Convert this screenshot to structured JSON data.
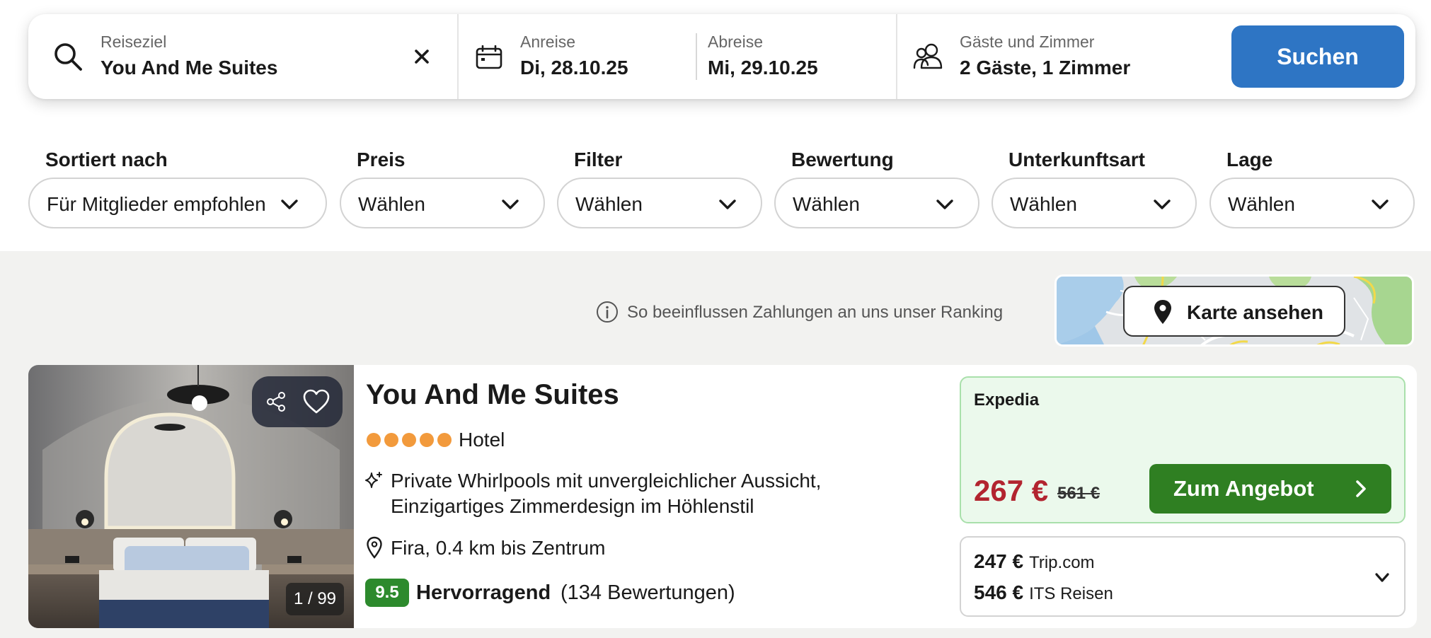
{
  "search": {
    "destination_label": "Reiseziel",
    "destination_value": "You And Me Suites",
    "checkin_label": "Anreise",
    "checkin_value": "Di, 28.10.25",
    "checkout_label": "Abreise",
    "checkout_value": "Mi, 29.10.25",
    "guests_label": "Gäste und Zimmer",
    "guests_value": "2 Gäste, 1 Zimmer",
    "search_button": "Suchen",
    "icons": [
      "search-icon",
      "close-icon",
      "calendar-icon",
      "guests-icon"
    ]
  },
  "filters": [
    {
      "label": "Sortiert nach",
      "value": "Für Mitglieder empfohlen"
    },
    {
      "label": "Preis",
      "value": "Wählen"
    },
    {
      "label": "Filter",
      "value": "Wählen"
    },
    {
      "label": "Bewertung",
      "value": "Wählen"
    },
    {
      "label": "Unterkunftsart",
      "value": "Wählen"
    },
    {
      "label": "Lage",
      "value": "Wählen"
    }
  ],
  "ranking_info": "So beeinflussen Zahlungen an uns unser Ranking",
  "map": {
    "button_label": "Karte ansehen"
  },
  "hotel": {
    "name": "You And Me Suites",
    "stars": 5,
    "type": "Hotel",
    "features_line1": "Private Whirlpools mit unvergleichlicher Aussicht,",
    "features_line2": "Einzigartiges Zimmerdesign im Höhlenstil",
    "location": "Fira, 0.4 km bis Zentrum",
    "rating_score": "9.5",
    "rating_label": "Hervorragend",
    "rating_count": "(134 Bewertungen)",
    "image_counter": "1 / 99",
    "best_deal": {
      "provider": "Expedia",
      "price": "267 €",
      "old_price": "561 €",
      "button_label": "Zum Angebot"
    },
    "other_offers": [
      {
        "price": "247 €",
        "provider": "Trip.com"
      },
      {
        "price": "546 €",
        "provider": "ITS Reisen"
      }
    ]
  },
  "colors": {
    "search_button": "#2e75c4",
    "deal_button": "#2f7f22",
    "deal_price": "#b2242f",
    "rating_badge": "#2d8a2d",
    "stars": "#f29a3c",
    "deal_background": "#ebf9ec"
  }
}
